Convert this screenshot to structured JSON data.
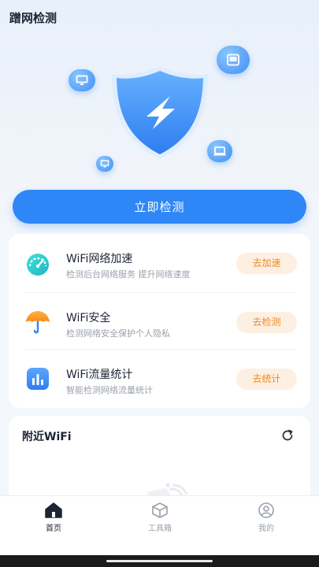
{
  "app": {
    "title": "蹭网检测"
  },
  "hero": {
    "shield_icon": "shield-bolt-icon",
    "float_icons": [
      "monitor-icon",
      "tablet-icon",
      "laptop-icon",
      "monitor-icon"
    ]
  },
  "check_button": {
    "label": "立即检测"
  },
  "features": [
    {
      "title": "WiFi网络加速",
      "desc": "检测后台网络服务 提升网络速度",
      "action": "去加速",
      "icon": "speedometer-icon"
    },
    {
      "title": "WiFi安全",
      "desc": "检测网络安全保护个人隐私",
      "action": "去检测",
      "icon": "umbrella-icon"
    },
    {
      "title": "WiFi流量统计",
      "desc": "智能检测网络流量统计",
      "action": "去统计",
      "icon": "bar-chart-icon"
    }
  ],
  "nearby": {
    "title": "附近WiFi",
    "refresh_icon": "refresh-icon"
  },
  "tabs": [
    {
      "label": "首页",
      "icon": "home-icon",
      "active": true
    },
    {
      "label": "工具箱",
      "icon": "toolbox-icon",
      "active": false
    },
    {
      "label": "我的",
      "icon": "profile-icon",
      "active": false
    }
  ],
  "colors": {
    "primary": "#2f86f6",
    "action_bg": "#fdf0e2",
    "action_text": "#ef8a23"
  }
}
